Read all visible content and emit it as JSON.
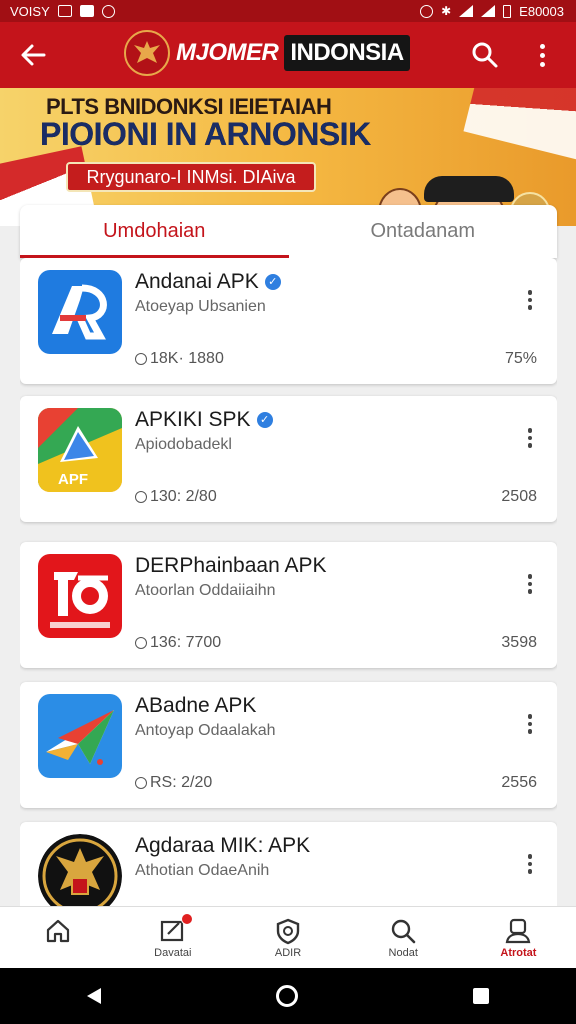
{
  "status_bar": {
    "left_text": "VOISY",
    "time": "E80003"
  },
  "header": {
    "brand_main": "MJOMER",
    "brand_box": "INDONSIA"
  },
  "banner": {
    "line1": "PLTS BNIDONKSI IEIETAIAH",
    "line2": "PIOIONI IN ARNONSIK",
    "line3": "Rrygunaro-I INMsi. DIAiva"
  },
  "tabs": [
    {
      "label": "Umdohaian",
      "active": true
    },
    {
      "label": "Ontadanam",
      "active": false
    }
  ],
  "apps": [
    {
      "title": "Andanai APK",
      "verified": true,
      "subtitle": "Atoeyap Ubsanien",
      "downloads": "18K· 1880",
      "rating": "75%",
      "icon": "ab-logo-icon"
    },
    {
      "title": "APKIKI SPK",
      "verified": true,
      "subtitle": "Apiodobadekl",
      "downloads": "130: 2/80",
      "rating": "2508",
      "icon": "drive-apk-icon"
    },
    {
      "title": "DERPhainbaan APK",
      "verified": false,
      "subtitle": "Atoorlan Oddaiiaihn",
      "downloads": "136: 7700",
      "rating": "3598",
      "icon": "red-logo-icon"
    },
    {
      "title": "ABadne APK",
      "verified": false,
      "subtitle": "Antoyap Odaalakah",
      "downloads": "RS: 2/20",
      "rating": "2556",
      "icon": "paper-plane-icon"
    },
    {
      "title": "Agdaraa MIK: APK",
      "verified": false,
      "subtitle": "Athotian OdaeAnih",
      "downloads": "",
      "rating": "",
      "icon": "garuda-emblem-icon"
    }
  ],
  "bottom_nav": [
    {
      "label": "",
      "icon": "home-icon",
      "active": false
    },
    {
      "label": "Davatai",
      "icon": "edit-icon",
      "active": false,
      "badge": true
    },
    {
      "label": "ADIR",
      "icon": "shield-icon",
      "active": false
    },
    {
      "label": "Nodat",
      "icon": "search-icon",
      "active": false
    },
    {
      "label": "Atrotat",
      "icon": "profile-icon",
      "active": true
    }
  ],
  "colors": {
    "primary": "#c4141b",
    "status_bar": "#a10f14",
    "accent_blue": "#2f7fe0"
  }
}
